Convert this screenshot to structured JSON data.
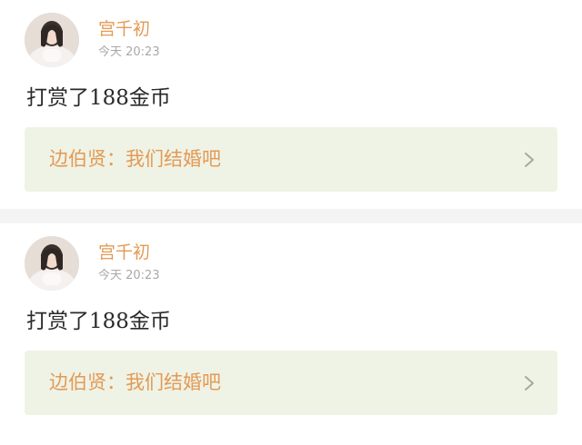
{
  "posts": [
    {
      "user_name": "宫千初",
      "time": "今天  20:23",
      "reward_text": "打赏了188金币",
      "quote_text": "边伯贤：我们结婚吧",
      "avatar_icon": "user-avatar-photo",
      "chevron_icon": "chevron-right-icon"
    },
    {
      "user_name": "宫千初",
      "time": "今天  20:23",
      "reward_text": "打赏了188金币",
      "quote_text": "边伯贤：我们结婚吧",
      "avatar_icon": "user-avatar-photo",
      "chevron_icon": "chevron-right-icon"
    }
  ],
  "colors": {
    "accent": "#e39a55",
    "quote_background": "#eff3e5",
    "separator": "#f4f4f4",
    "meta_text": "#a9a9a9",
    "body_text": "#2a2a2a"
  }
}
